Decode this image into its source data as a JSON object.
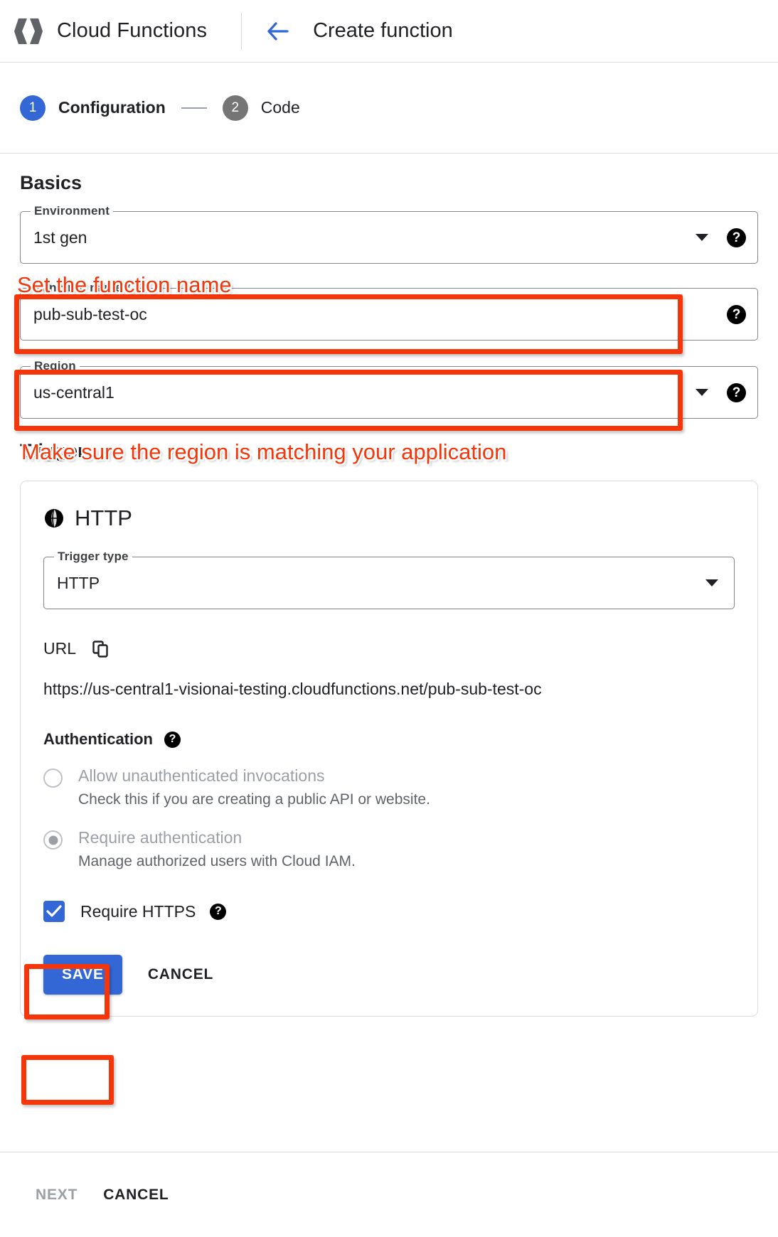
{
  "header": {
    "logo_icon": "cloud-functions-icon",
    "product": "Cloud Functions",
    "back_icon": "back-arrow-icon",
    "page_title": "Create function"
  },
  "stepper": {
    "steps": [
      {
        "num": "1",
        "label": "Configuration",
        "state": "active"
      },
      {
        "num": "2",
        "label": "Code",
        "state": "inactive"
      }
    ]
  },
  "basics": {
    "title": "Basics",
    "environment": {
      "label": "Environment",
      "value": "1st gen",
      "help_icon": "help-icon",
      "caret_icon": "chevron-down-icon"
    },
    "function_name": {
      "label": "Function name *",
      "value": "pub-sub-test-oc",
      "help_icon": "help-icon"
    },
    "region": {
      "label": "Region",
      "value": "us-central1",
      "help_icon": "help-icon",
      "caret_icon": "chevron-down-icon"
    }
  },
  "annotations": [
    {
      "text": "Set the function name",
      "color": "#f4360a"
    },
    {
      "text": "Make sure the region is matching your application",
      "color": "#f4360a"
    }
  ],
  "trigger": {
    "heading": "Trigger",
    "card_icon": "globe-icon",
    "card_title": "HTTP",
    "trigger_type": {
      "label": "Trigger type",
      "value": "HTTP",
      "caret_icon": "chevron-down-icon"
    },
    "url": {
      "label": "URL",
      "copy_icon": "copy-icon",
      "value": "https://us-central1-visionai-testing.cloudfunctions.net/pub-sub-test-oc"
    },
    "authentication": {
      "label": "Authentication",
      "help_icon": "help-icon",
      "options": [
        {
          "title": "Allow unauthenticated invocations",
          "subtitle": "Check this if you are creating a public API or website.",
          "selected": false
        },
        {
          "title": "Require authentication",
          "subtitle": "Manage authorized users with Cloud IAM.",
          "selected": true
        }
      ]
    },
    "require_https": {
      "label": "Require HTTPS",
      "checked": true,
      "help_icon": "help-icon"
    },
    "save_label": "SAVE",
    "cancel_label": "CANCEL"
  },
  "footer": {
    "next_label": "NEXT",
    "cancel_label": "CANCEL"
  },
  "colors": {
    "accent_blue": "#3367d6",
    "annotation_red": "#f4360a",
    "step_inactive": "#757575"
  }
}
